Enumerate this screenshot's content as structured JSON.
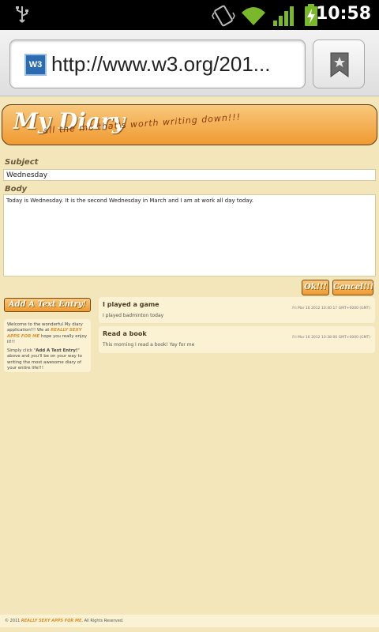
{
  "status_bar": {
    "time": "10:58",
    "icons": [
      "usb-icon",
      "vibrate-icon",
      "wifi-icon",
      "signal-icon",
      "battery-charging-icon"
    ]
  },
  "browser": {
    "favicon_text": "W3",
    "url": "http://www.w3.org/201...",
    "bookmark_icon": "bookmark-icon"
  },
  "header": {
    "title": "My Diary",
    "tagline": "all the mc that's worth writing down!!!"
  },
  "form": {
    "subject_label": "Subject",
    "subject_value": "Wednesday",
    "body_label": "Body",
    "body_value": "Today is Wednesday. It is the second Wednesday in March and I am at work all day today.",
    "ok_label": "Ok!!!",
    "cancel_label": "Cancel!!!"
  },
  "sidebar": {
    "add_entry_label": "Add A Text Entry!",
    "welcome_1": "Welcome to the wonderful My diary application!!! We at ",
    "brand": "REALLY SEXY APPS FOR ME",
    "welcome_2": " hope you really enjoy it!!!",
    "instructions_1": "Simply click \"",
    "instructions_button": "Add A Text Entry!",
    "instructions_2": "\" above and you'll be on your way to writing the most awesome diary of your entire life!!!"
  },
  "entries": [
    {
      "title": "I played a game",
      "description": "I played badminton today",
      "date": "Fri Mar 16 2012 10:40:17 GMT+0000 (GMT)"
    },
    {
      "title": "Read a book",
      "description": "This morning I read a book! Yay for me",
      "date": "Fri Mar 16 2012 10:38:00 GMT+0000 (GMT)"
    }
  ],
  "footer": {
    "prefix": "© 2011 ",
    "brand": "REALLY SEXY APPS FOR ME",
    "suffix": ". All Rights Reserved."
  }
}
